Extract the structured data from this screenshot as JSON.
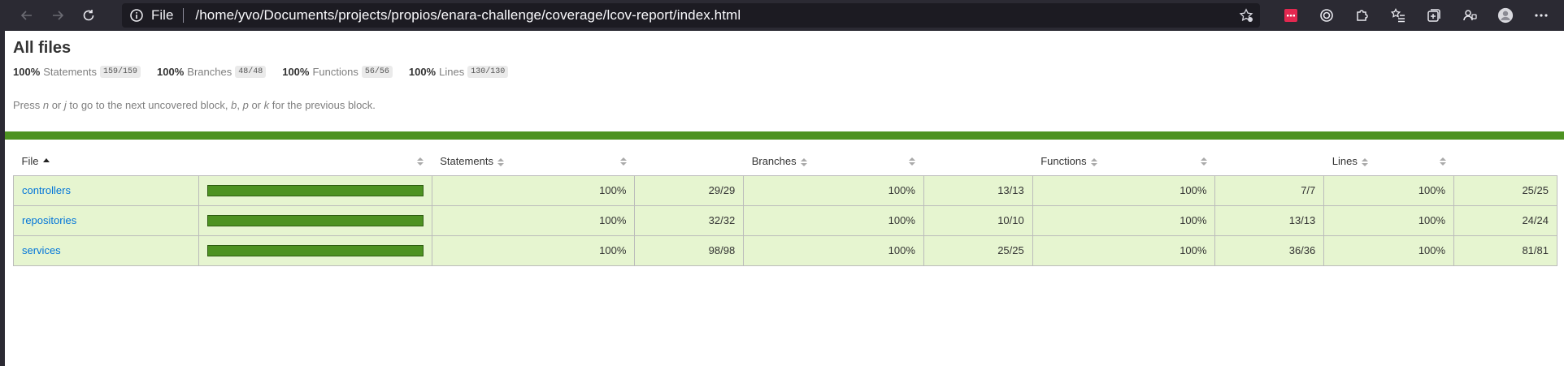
{
  "browser": {
    "url_scheme_label": "File",
    "url": "/home/yvo/Documents/projects/propios/enara-challenge/coverage/lcov-report/index.html"
  },
  "page": {
    "title": "All files",
    "summary": [
      {
        "pct": "100%",
        "label": "Statements",
        "fraction": "159/159"
      },
      {
        "pct": "100%",
        "label": "Branches",
        "fraction": "48/48"
      },
      {
        "pct": "100%",
        "label": "Functions",
        "fraction": "56/56"
      },
      {
        "pct": "100%",
        "label": "Lines",
        "fraction": "130/130"
      }
    ],
    "hint": {
      "p1": "Press ",
      "k1": "n",
      "p2": " or ",
      "k2": "j",
      "p3": " to go to the next uncovered block, ",
      "k3": "b",
      "p4": ", ",
      "k4": "p",
      "p5": " or ",
      "k5": "k",
      "p6": " for the previous block."
    },
    "status_color": "#4d9221"
  },
  "table": {
    "headers": [
      "File",
      "",
      "Statements",
      "",
      "Branches",
      "",
      "Functions",
      "",
      "Lines",
      ""
    ],
    "rows": [
      {
        "file": "controllers",
        "coverage": 1.0,
        "stmt_pct": "100%",
        "stmt_frac": "29/29",
        "br_pct": "100%",
        "br_frac": "13/13",
        "fn_pct": "100%",
        "fn_frac": "7/7",
        "ln_pct": "100%",
        "ln_frac": "25/25"
      },
      {
        "file": "repositories",
        "coverage": 1.0,
        "stmt_pct": "100%",
        "stmt_frac": "32/32",
        "br_pct": "100%",
        "br_frac": "10/10",
        "fn_pct": "100%",
        "fn_frac": "13/13",
        "ln_pct": "100%",
        "ln_frac": "24/24"
      },
      {
        "file": "services",
        "coverage": 1.0,
        "stmt_pct": "100%",
        "stmt_frac": "98/98",
        "br_pct": "100%",
        "br_frac": "25/25",
        "fn_pct": "100%",
        "fn_frac": "36/36",
        "ln_pct": "100%",
        "ln_frac": "81/81"
      }
    ]
  }
}
